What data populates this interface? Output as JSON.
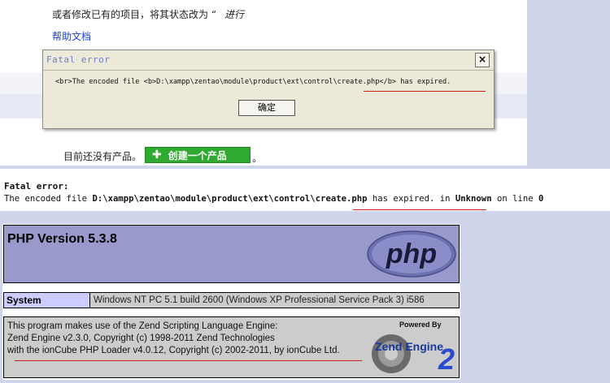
{
  "app": {
    "intro_text": "或者修改已有的项目，将其状态改为 “",
    "intro_status": "进行",
    "help_link": "帮助文档",
    "no_product_text": "目前还没有产品。",
    "create_button": "创建一个产品",
    "trailing_dot": "。"
  },
  "dialog": {
    "title": "Fatal error",
    "close": "×",
    "message": "<br>The encoded file <b>D:\\xampp\\zentao\\module\\product\\ext\\control\\create.php</b> has expired.",
    "ok_button": "确定"
  },
  "fatal": {
    "heading": "Fatal error:",
    "prefix": "The encoded file ",
    "path": "D:\\xampp\\zentao\\module\\product\\ext\\control\\create.php",
    "suffix": " has expired. in ",
    "unknown": "Unknown",
    "online": " on line ",
    "line": "0"
  },
  "phpinfo": {
    "version": "PHP Version 5.3.8",
    "logo_text": "php",
    "system_label": "System",
    "system_value": "Windows NT PC  5.1 build 2600 (Windows XP Professional Service Pack 3) i586",
    "zend_line1": "This program makes use of the Zend Scripting Language Engine:",
    "zend_line2": "Zend Engine v2.3.0, Copyright (c) 1998-2011 Zend Technologies",
    "zend_line3": "   with the ionCube PHP Loader v4.0.12, Copyright (c) 2002-2011, by ionCube Ltd.",
    "powered_by": "Powered By",
    "zend_logo_text": "Zend Engine",
    "zend_logo_num": "2"
  },
  "colors": {
    "php_header": "#9999cc",
    "system_label": "#ccccff",
    "create_button": "#2fa92f",
    "underline": "#d21c1c",
    "help_link": "#1d3fd0"
  }
}
